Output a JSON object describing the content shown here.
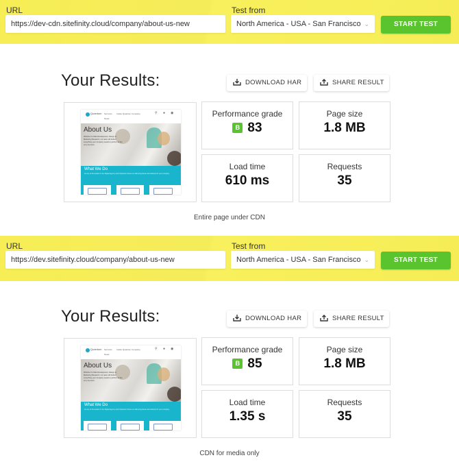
{
  "sections": [
    {
      "form": {
        "url_label": "URL",
        "url_value": "https://dev-cdn.sitefinity.cloud/company/about-us-new",
        "test_from_label": "Test from",
        "test_from_value": "North America - USA - San Francisco",
        "start_button": "START TEST"
      },
      "results": {
        "title": "Your Results:",
        "download_har": "DOWNLOAD HAR",
        "share_result": "SHARE RESULT",
        "thumbnail": {
          "logo": "Quantum",
          "nav": [
            "Services",
            "Inside Quantum",
            "Company",
            "News"
          ],
          "hero_title": "About Us",
          "hero_text": "Whether it's Web Development, Design or Marketing Research, our team will deliver everything your company needs to perform at the very top level.",
          "section_title": "What We Do",
          "section_text": "As one of the leaders in the Digital Agency world Quantum thrives on delivering ideas and solutions for your company."
        },
        "metrics": {
          "performance_grade": {
            "label": "Performance grade",
            "grade": "B",
            "value": "83"
          },
          "page_size": {
            "label": "Page size",
            "value": "1.8 MB"
          },
          "load_time": {
            "label": "Load time",
            "value": "610 ms"
          },
          "requests": {
            "label": "Requests",
            "value": "35"
          }
        }
      },
      "caption": "Entire page under CDN"
    },
    {
      "form": {
        "url_label": "URL",
        "url_value": "https://dev.sitefinity.cloud/company/about-us-new",
        "test_from_label": "Test from",
        "test_from_value": "North America - USA - San Francisco",
        "start_button": "START TEST"
      },
      "results": {
        "title": "Your Results:",
        "download_har": "DOWNLOAD HAR",
        "share_result": "SHARE RESULT",
        "thumbnail": {
          "logo": "Quantum",
          "nav": [
            "Services",
            "Inside Quantum",
            "Company",
            "News"
          ],
          "hero_title": "About Us",
          "hero_text": "Whether it's Web Development, Design or Marketing Research, our team will deliver everything your company needs to perform at the very top level.",
          "section_title": "What We Do",
          "section_text": "As one of the leaders in the Digital Agency world Quantum thrives on delivering ideas and solutions for your company."
        },
        "metrics": {
          "performance_grade": {
            "label": "Performance grade",
            "grade": "B",
            "value": "85"
          },
          "page_size": {
            "label": "Page size",
            "value": "1.8 MB"
          },
          "load_time": {
            "label": "Load time",
            "value": "1.35 s"
          },
          "requests": {
            "label": "Requests",
            "value": "35"
          }
        }
      },
      "caption": "CDN for media only"
    }
  ],
  "colors": {
    "bar_yellow": "#f6ed56",
    "start_green": "#5ac42e",
    "grade_green": "#5ac42e",
    "teal": "#19b5cc"
  }
}
